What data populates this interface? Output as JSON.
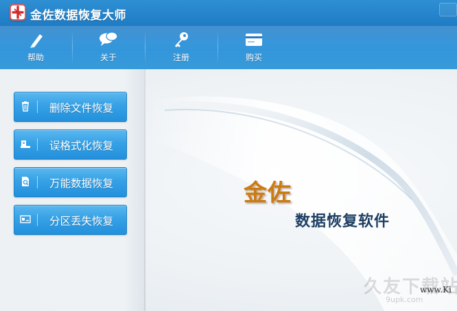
{
  "app": {
    "title": "金佐数据恢复大师"
  },
  "toolbar": [
    {
      "label": "帮助",
      "icon": "pencil-help-icon"
    },
    {
      "label": "关于",
      "icon": "chat-bubbles-icon"
    },
    {
      "label": "注册",
      "icon": "key-icon"
    },
    {
      "label": "购买",
      "icon": "credit-card-icon"
    }
  ],
  "menu": [
    {
      "label": "删除文件恢复",
      "icon": "trash-icon"
    },
    {
      "label": "误格式化恢复",
      "icon": "format-icon"
    },
    {
      "label": "万能数据恢复",
      "icon": "file-search-icon"
    },
    {
      "label": "分区丢失恢复",
      "icon": "partition-icon"
    }
  ],
  "brand": {
    "main": "金佐",
    "sub": "数据恢复软件"
  },
  "watermark": {
    "cn": "久友下载站",
    "url": "www.Ki",
    "url2": "9upk.com"
  },
  "colors": {
    "header": "#1f7cc5",
    "button": "#36a1e6",
    "brand_orange": "#cc7a12",
    "brand_navy": "#1d3f63"
  }
}
